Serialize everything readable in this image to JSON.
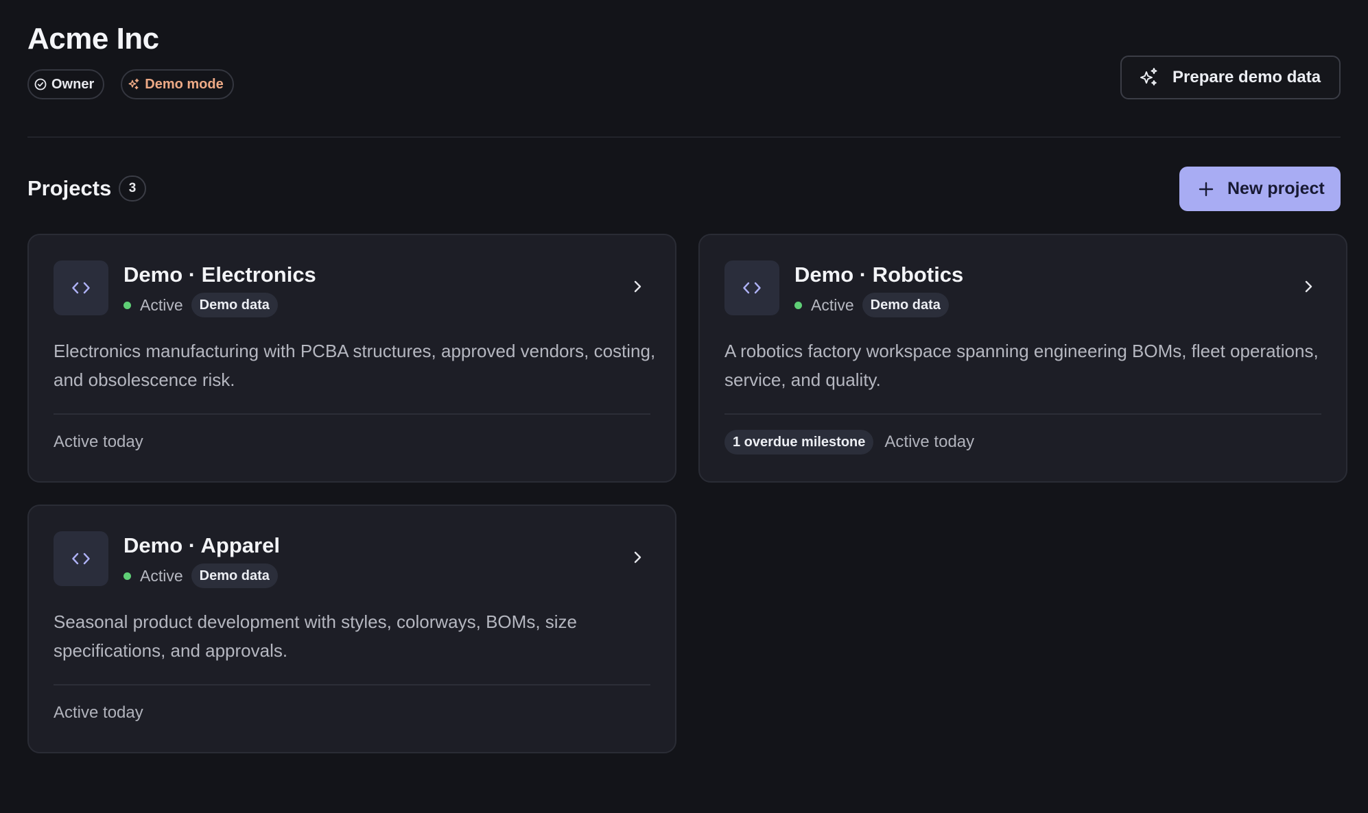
{
  "org": {
    "title": "Acme Inc",
    "role_badge": "Owner",
    "mode_badge": "Demo mode"
  },
  "actions": {
    "prepare_label": "Prepare demo data",
    "new_project_label": "New project"
  },
  "projects": {
    "heading": "Projects",
    "count": "3",
    "items": [
      {
        "title": "Demo · Electronics",
        "status": "Active",
        "tag": "Demo data",
        "description": "Electronics manufacturing with PCBA structures, approved vendors, costing, and obsolescence risk.",
        "milestone": "",
        "activity": "Active today"
      },
      {
        "title": "Demo · Robotics",
        "status": "Active",
        "tag": "Demo data",
        "description": "A robotics factory workspace spanning engineering BOMs, fleet operations, service, and quality.",
        "milestone": "1 overdue milestone",
        "activity": "Active today"
      },
      {
        "title": "Demo · Apparel",
        "status": "Active",
        "tag": "Demo data",
        "description": "Seasonal product development with styles, colorways, BOMs, size specifications, and approvals.",
        "milestone": "",
        "activity": "Active today"
      }
    ]
  },
  "colors": {
    "background": "#131419",
    "card": "#1d1e26",
    "accent": "#a8acf3",
    "demo_mode": "#eeaa86",
    "status_active": "#5fcf76"
  },
  "icons": {
    "owner": "check-circle-icon",
    "demo_mode": "sparkles-icon",
    "prepare": "sparkles-icon",
    "new_project": "plus-icon",
    "project": "code-brackets-icon",
    "open": "chevron-right-icon"
  }
}
